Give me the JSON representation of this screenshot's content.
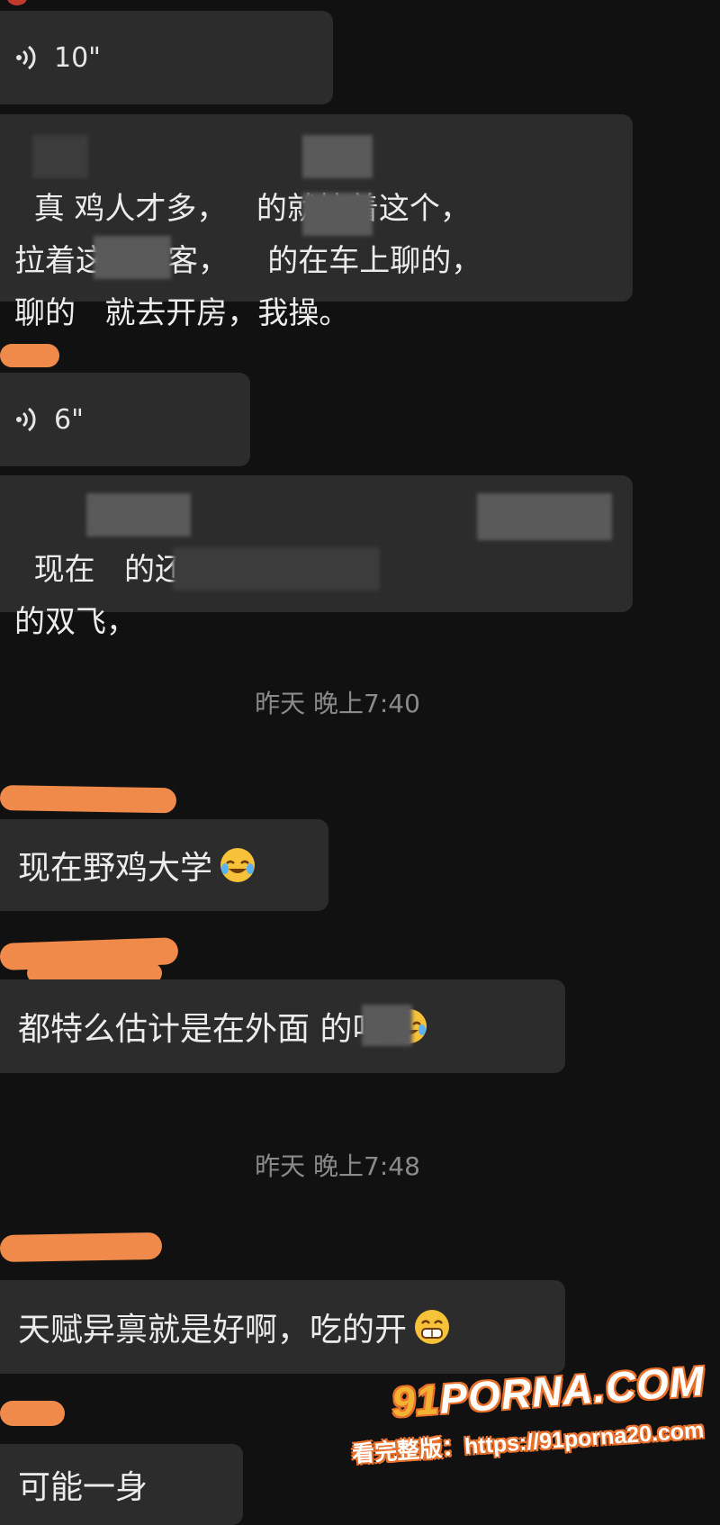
{
  "messages": [
    {
      "kind": "voice",
      "duration": "10\""
    },
    {
      "kind": "text",
      "text": "真 鸡人才多，   的就拉着这个，\n拉着这个乘客，    的在车上聊的，\n聊的   就去开房，我操。"
    },
    {
      "kind": "voice",
      "duration": "6\""
    },
    {
      "kind": "text",
      "text": "现在   的还玩起来上瘾，     \n的双飞，"
    },
    {
      "kind": "timestamp",
      "text": "昨天 晚上7:40"
    },
    {
      "kind": "text",
      "text": "现在野鸡大学",
      "emoji": "rofl-emoji"
    },
    {
      "kind": "text",
      "text": "都特么估计是在外面    的吧",
      "emoji": "rofl-emoji"
    },
    {
      "kind": "timestamp",
      "text": "昨天 晚上7:48"
    },
    {
      "kind": "text",
      "text": "天赋异禀就是好啊，吃的开",
      "emoji": "grin-emoji"
    },
    {
      "kind": "text",
      "text": "可能一身"
    }
  ],
  "watermark": {
    "logo_prefix": "91",
    "logo_main": "PORNA.COM",
    "url_text": "看完整版：https://91porna20.com"
  },
  "colors": {
    "background": "#111111",
    "bubble": "#2c2c2c",
    "text": "#ececec",
    "timestamp": "#8a8a8a",
    "redaction_scribble": "#f08a4b",
    "watermark_orange": "#e8702a"
  }
}
